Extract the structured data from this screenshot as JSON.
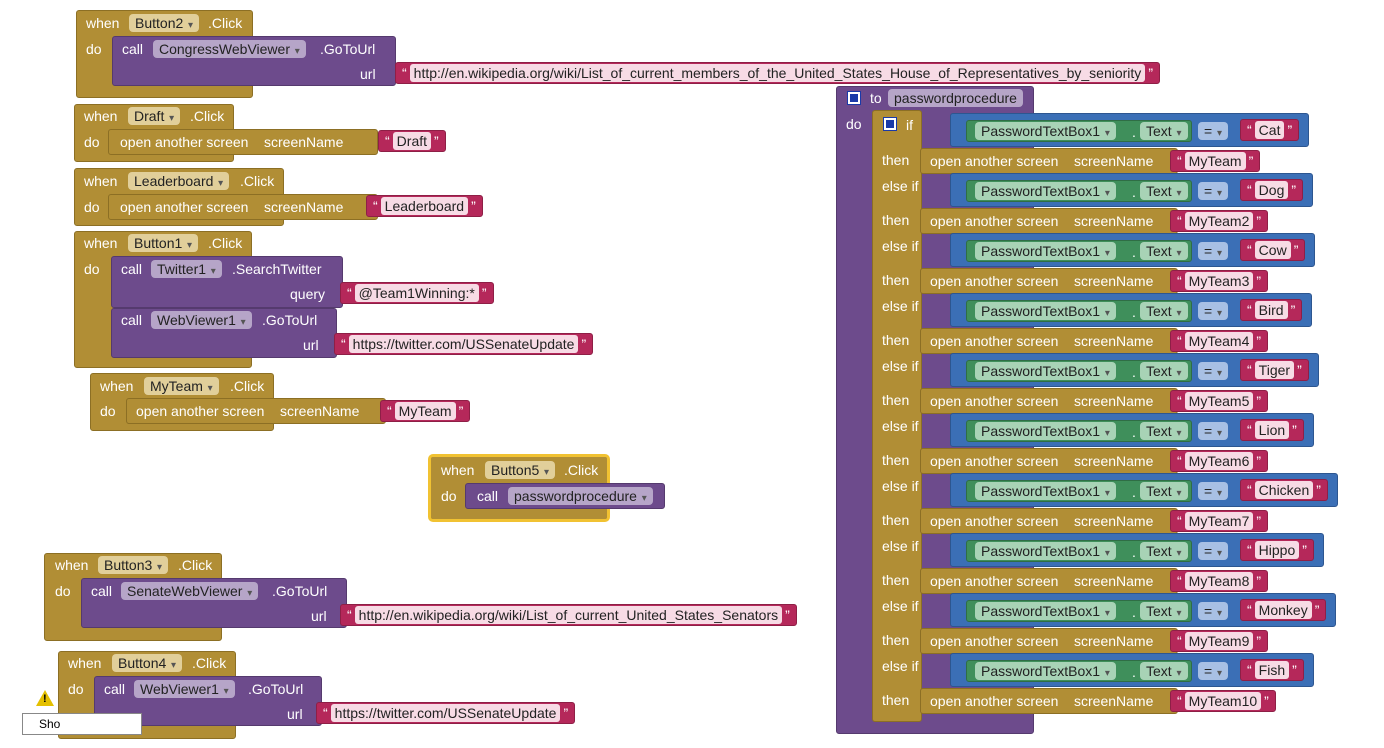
{
  "events": [
    {
      "id": "b2",
      "when": "when",
      "component": "Button2",
      "event": ".Click",
      "do": "do",
      "call": "call",
      "target": "CongressWebViewer",
      "method": ".GoToUrl",
      "param": "url",
      "value": "http://en.wikipedia.org/wiki/List_of_current_members_of_the_United_States_House_of_Representatives_by_seniority"
    },
    {
      "id": "draft",
      "when": "when",
      "component": "Draft",
      "event": ".Click",
      "do": "do",
      "action": "open another screen",
      "param": "screenName",
      "value": "Draft"
    },
    {
      "id": "leader",
      "when": "when",
      "component": "Leaderboard",
      "event": ".Click",
      "do": "do",
      "action": "open another screen",
      "param": "screenName",
      "value": "Leaderboard"
    },
    {
      "id": "b1",
      "when": "when",
      "component": "Button1",
      "event": ".Click",
      "do": "do",
      "call": "call",
      "target": "Twitter1",
      "method": ".SearchTwitter",
      "param": "query",
      "value": "@Team1Winning:*",
      "call2": "call",
      "target2": "WebViewer1",
      "method2": ".GoToUrl",
      "param2": "url",
      "value2": "https://twitter.com/USSenateUpdate"
    },
    {
      "id": "myteam",
      "when": "when",
      "component": "MyTeam",
      "event": ".Click",
      "do": "do",
      "action": "open another screen",
      "param": "screenName",
      "value": "MyTeam"
    },
    {
      "id": "b5",
      "when": "when",
      "component": "Button5",
      "event": ".Click",
      "do": "do",
      "call": "call",
      "target": "passwordprocedure"
    },
    {
      "id": "b3",
      "when": "when",
      "component": "Button3",
      "event": ".Click",
      "do": "do",
      "call": "call",
      "target": "SenateWebViewer",
      "method": ".GoToUrl",
      "param": "url",
      "value": "http://en.wikipedia.org/wiki/List_of_current_United_States_Senators"
    },
    {
      "id": "b4",
      "when": "when",
      "component": "Button4",
      "event": ".Click",
      "do": "do",
      "call": "call",
      "target": "WebViewer1",
      "method": ".GoToUrl",
      "param": "url",
      "value": "https://twitter.com/USSenateUpdate"
    }
  ],
  "procedure": {
    "to": "to",
    "name": "passwordprocedure",
    "do": "do",
    "if": "if",
    "then": "then",
    "else_if": "else if",
    "component": "PasswordTextBox1",
    "dot": ".",
    "property": "Text",
    "op": "=",
    "action": "open another screen",
    "param": "screenName",
    "branches": [
      {
        "password": "Cat",
        "screen": "MyTeam"
      },
      {
        "password": "Dog",
        "screen": "MyTeam2"
      },
      {
        "password": "Cow",
        "screen": "MyTeam3"
      },
      {
        "password": "Bird",
        "screen": "MyTeam4"
      },
      {
        "password": "Tiger",
        "screen": "MyTeam5"
      },
      {
        "password": "Lion",
        "screen": "MyTeam6"
      },
      {
        "password": "Chicken",
        "screen": "MyTeam7"
      },
      {
        "password": "Hippo",
        "screen": "MyTeam8"
      },
      {
        "password": "Monkey",
        "screen": "MyTeam9"
      },
      {
        "password": "Fish",
        "screen": "MyTeam10"
      }
    ]
  },
  "footer": {
    "warning_icon": "warning-icon",
    "show_label": "Sho"
  },
  "colors": {
    "event": "#b18e35",
    "call": "#6d4b8c",
    "logic": "#3b6fb6",
    "text": "#b5285a",
    "property": "#3f8f5b",
    "selection": "#f1c232"
  }
}
